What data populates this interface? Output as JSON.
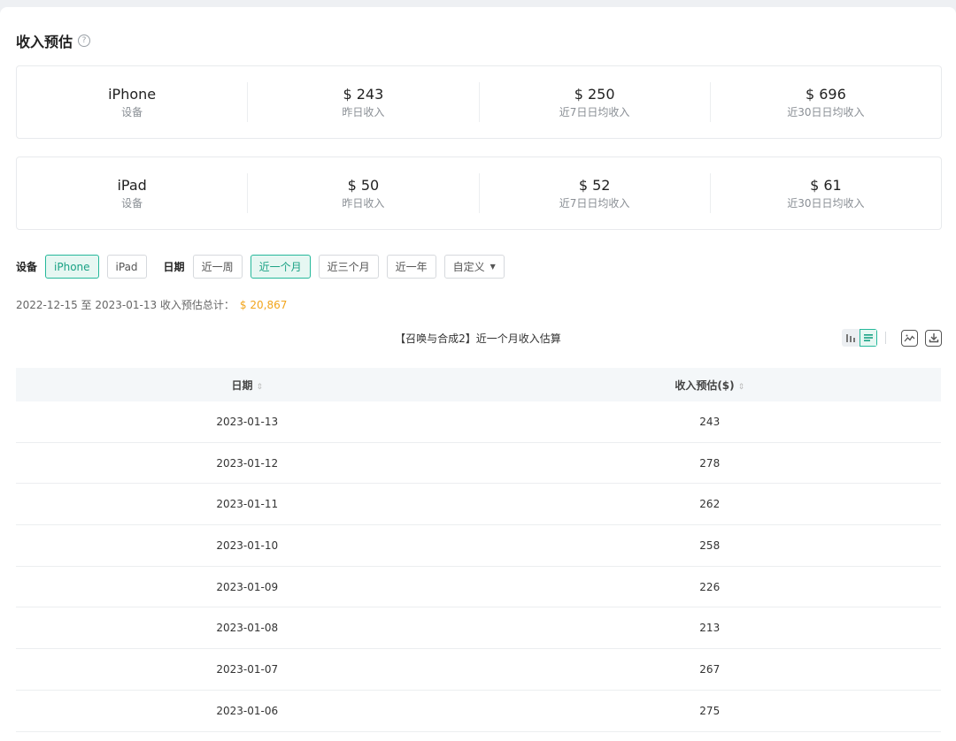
{
  "header": {
    "title": "收入预估",
    "help_glyph": "?"
  },
  "stats": [
    {
      "device": "iPhone",
      "device_label": "设备",
      "yesterday": "$ 243",
      "yesterday_label": "昨日收入",
      "avg7": "$ 250",
      "avg7_label": "近7日日均收入",
      "avg30": "$ 696",
      "avg30_label": "近30日日均收入"
    },
    {
      "device": "iPad",
      "device_label": "设备",
      "yesterday": "$ 50",
      "yesterday_label": "昨日收入",
      "avg7": "$ 52",
      "avg7_label": "近7日日均收入",
      "avg30": "$ 61",
      "avg30_label": "近30日日均收入"
    }
  ],
  "filters": {
    "device_label": "设备",
    "devices": [
      "iPhone",
      "iPad"
    ],
    "selected_device": "iPhone",
    "date_label": "日期",
    "ranges": [
      "近一周",
      "近一个月",
      "近三个月",
      "近一年"
    ],
    "selected_range": "近一个月",
    "custom_label": "自定义"
  },
  "summary": {
    "text": "2022-12-15 至 2023-01-13 收入预估总计：",
    "amount": "$ 20,867"
  },
  "table": {
    "title": "【召唤与合成2】近一个月收入估算",
    "columns": [
      "日期",
      "收入预估($)"
    ],
    "rows": [
      [
        "2023-01-13",
        "243"
      ],
      [
        "2023-01-12",
        "278"
      ],
      [
        "2023-01-11",
        "262"
      ],
      [
        "2023-01-10",
        "258"
      ],
      [
        "2023-01-09",
        "226"
      ],
      [
        "2023-01-08",
        "213"
      ],
      [
        "2023-01-07",
        "267"
      ],
      [
        "2023-01-06",
        "275"
      ]
    ]
  },
  "colors": {
    "accent": "#25b89a",
    "amount": "#f2a51c"
  },
  "icons": [
    "help-icon",
    "bar-chart-icon",
    "list-icon",
    "image-icon",
    "download-icon",
    "caret-down-icon",
    "sort-icon"
  ]
}
